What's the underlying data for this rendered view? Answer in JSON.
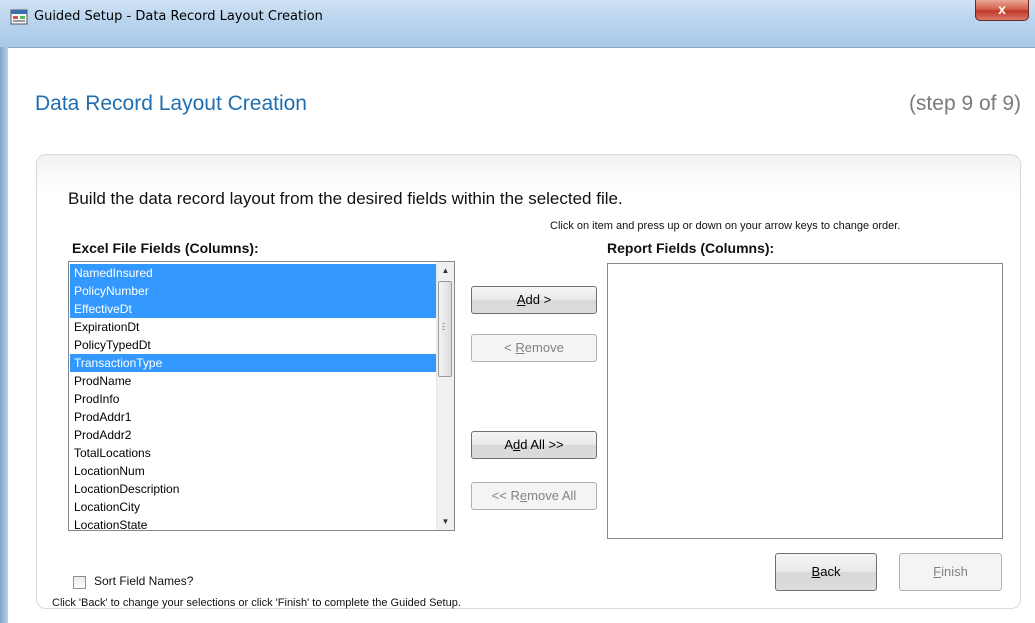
{
  "window": {
    "title": "Guided Setup - Data Record Layout Creation",
    "close_label": "x"
  },
  "header": {
    "title": "Data Record Layout Creation",
    "step": "(step 9 of 9)"
  },
  "instructions": {
    "main": "Build the data record layout from the desired fields within the selected file.",
    "hint": "Click on item and press up or down on your arrow keys to change order."
  },
  "excel_fields": {
    "label": "Excel File Fields (Columns):",
    "items": [
      {
        "name": "NamedInsured",
        "selected": true
      },
      {
        "name": "PolicyNumber",
        "selected": true
      },
      {
        "name": "EffectiveDt",
        "selected": true
      },
      {
        "name": "ExpirationDt",
        "selected": false
      },
      {
        "name": "PolicyTypedDt",
        "selected": false
      },
      {
        "name": "TransactionType",
        "selected": true
      },
      {
        "name": "ProdName",
        "selected": false
      },
      {
        "name": "ProdInfo",
        "selected": false
      },
      {
        "name": "ProdAddr1",
        "selected": false
      },
      {
        "name": "ProdAddr2",
        "selected": false
      },
      {
        "name": "TotalLocations",
        "selected": false
      },
      {
        "name": "LocationNum",
        "selected": false
      },
      {
        "name": "LocationDescription",
        "selected": false
      },
      {
        "name": "LocationCity",
        "selected": false
      },
      {
        "name": "LocationState",
        "selected": false
      }
    ]
  },
  "report_fields": {
    "label": "Report Fields (Columns):",
    "items": []
  },
  "buttons": {
    "add": {
      "label": "Add >",
      "mnemonic": "A",
      "enabled": true
    },
    "remove": {
      "label": "< Remove",
      "mnemonic": "R",
      "enabled": false
    },
    "add_all": {
      "label": "Add All >>",
      "mnemonic": "d",
      "enabled": true
    },
    "remove_all": {
      "label": "<< Remove All",
      "mnemonic": "e",
      "enabled": false
    },
    "back": {
      "label": "Back",
      "mnemonic": "B",
      "enabled": true
    },
    "finish": {
      "label": "Finish",
      "mnemonic": "F",
      "enabled": false
    }
  },
  "options": {
    "sort_label": "Sort Field Names?",
    "sort_checked": false
  },
  "footer": {
    "text": "Click 'Back' to change your selections or click 'Finish' to complete the Guided Setup."
  },
  "colors": {
    "title_blue": "#1f6fb0",
    "selection": "#3399ff"
  }
}
